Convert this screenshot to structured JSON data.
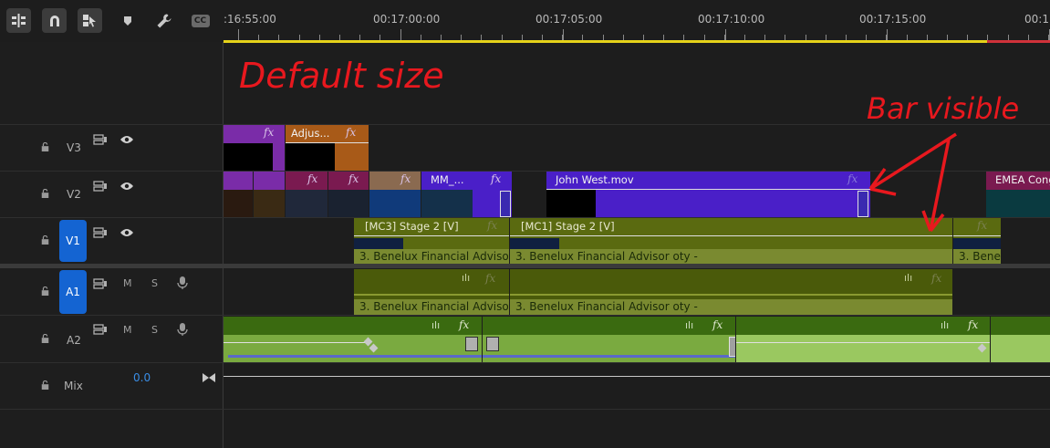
{
  "toolbar": {
    "tools": [
      {
        "icon": "insert-sequence-icon"
      },
      {
        "icon": "snap-magnet-icon"
      },
      {
        "icon": "linked-selection-icon"
      },
      {
        "icon": "marker-icon"
      },
      {
        "icon": "wrench-settings-icon"
      },
      {
        "icon": "captions-cc-icon",
        "label": "CC"
      }
    ]
  },
  "ruler": {
    "timecodes": [
      ":16:55:00",
      "00:17:00:00",
      "00:17:05:00",
      "00:17:10:00",
      "00:17:15:00",
      "00:1"
    ]
  },
  "tracks": {
    "v3": {
      "label": "V3"
    },
    "v2": {
      "label": "V2"
    },
    "v1": {
      "label": "V1",
      "target": "V1"
    },
    "a1": {
      "label": "A1",
      "target": "A1",
      "mute": "M",
      "solo": "S"
    },
    "a2": {
      "label": "A2",
      "mute": "M",
      "solo": "S"
    },
    "mix": {
      "label": "Mix",
      "value": "0.0"
    }
  },
  "clips": {
    "v3_adjust": "Adjus...",
    "v2_mm": "MM_...",
    "v2_john": "John West.mov",
    "v2_emea": "EMEA Cong",
    "v1_mc3": "[MC3] Stage 2 [V]",
    "v1_mc1": "[MC1] Stage 2 [V]",
    "v1_audio1": "3. Benelux Financial Adviso",
    "v1_audio2": "3. Benelux Financial Advisor oty -",
    "v1_audio3": "3. Bene",
    "a1_audio1": "3. Benelux Financial Adviso",
    "a1_audio2": "3. Benelux Financial Advisor oty -",
    "fx": "fx"
  },
  "annotations": {
    "note1": "Default size",
    "note2": "Bar visible"
  },
  "colors": {
    "playhead_bar": "#e5d21a",
    "in_out_red": "#d0323a",
    "video_purple": "#7a2ca8",
    "video_violet": "#4a1fc8",
    "video_orange": "#a85a18",
    "video_magenta": "#7a1a50",
    "video_tan": "#8a6a50",
    "v1_olive": "#5a6a10",
    "audio_green": "#3a6a10",
    "track_target_blue": "#1464d2",
    "annotation_red": "#e8181e"
  }
}
